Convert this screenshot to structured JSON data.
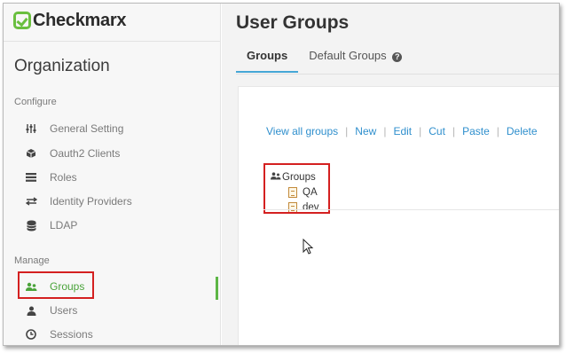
{
  "sidebar": {
    "logo_text": "Checkmarx",
    "org_title": "Organization",
    "configure_label": "Configure",
    "configure_items": [
      {
        "label": "General Setting",
        "icon": "sliders-icon"
      },
      {
        "label": "Oauth2 Clients",
        "icon": "cube-icon"
      },
      {
        "label": "Roles",
        "icon": "roles-icon"
      },
      {
        "label": "Identity Providers",
        "icon": "arrows-icon"
      },
      {
        "label": "LDAP",
        "icon": "database-icon"
      }
    ],
    "manage_label": "Manage",
    "manage_items": [
      {
        "label": "Groups",
        "icon": "users-group-icon",
        "active": true
      },
      {
        "label": "Users",
        "icon": "user-icon"
      },
      {
        "label": "Sessions",
        "icon": "clock-icon"
      }
    ]
  },
  "main": {
    "title": "User Groups",
    "tabs": [
      {
        "label": "Groups",
        "active": true
      },
      {
        "label": "Default Groups",
        "help_icon": "question-circle-icon"
      }
    ],
    "toolbar": {
      "view_all": "View all groups",
      "new": "New",
      "edit": "Edit",
      "cut": "Cut",
      "paste": "Paste",
      "delete": "Delete"
    },
    "tree": {
      "root": "Groups",
      "children": [
        "QA",
        "dev"
      ]
    }
  },
  "colors": {
    "brand_green": "#6abf3f",
    "active_green": "#4aa33a",
    "link_blue": "#2f8fcd",
    "tab_underline": "#45a7d6",
    "highlight_red": "#d42020"
  }
}
